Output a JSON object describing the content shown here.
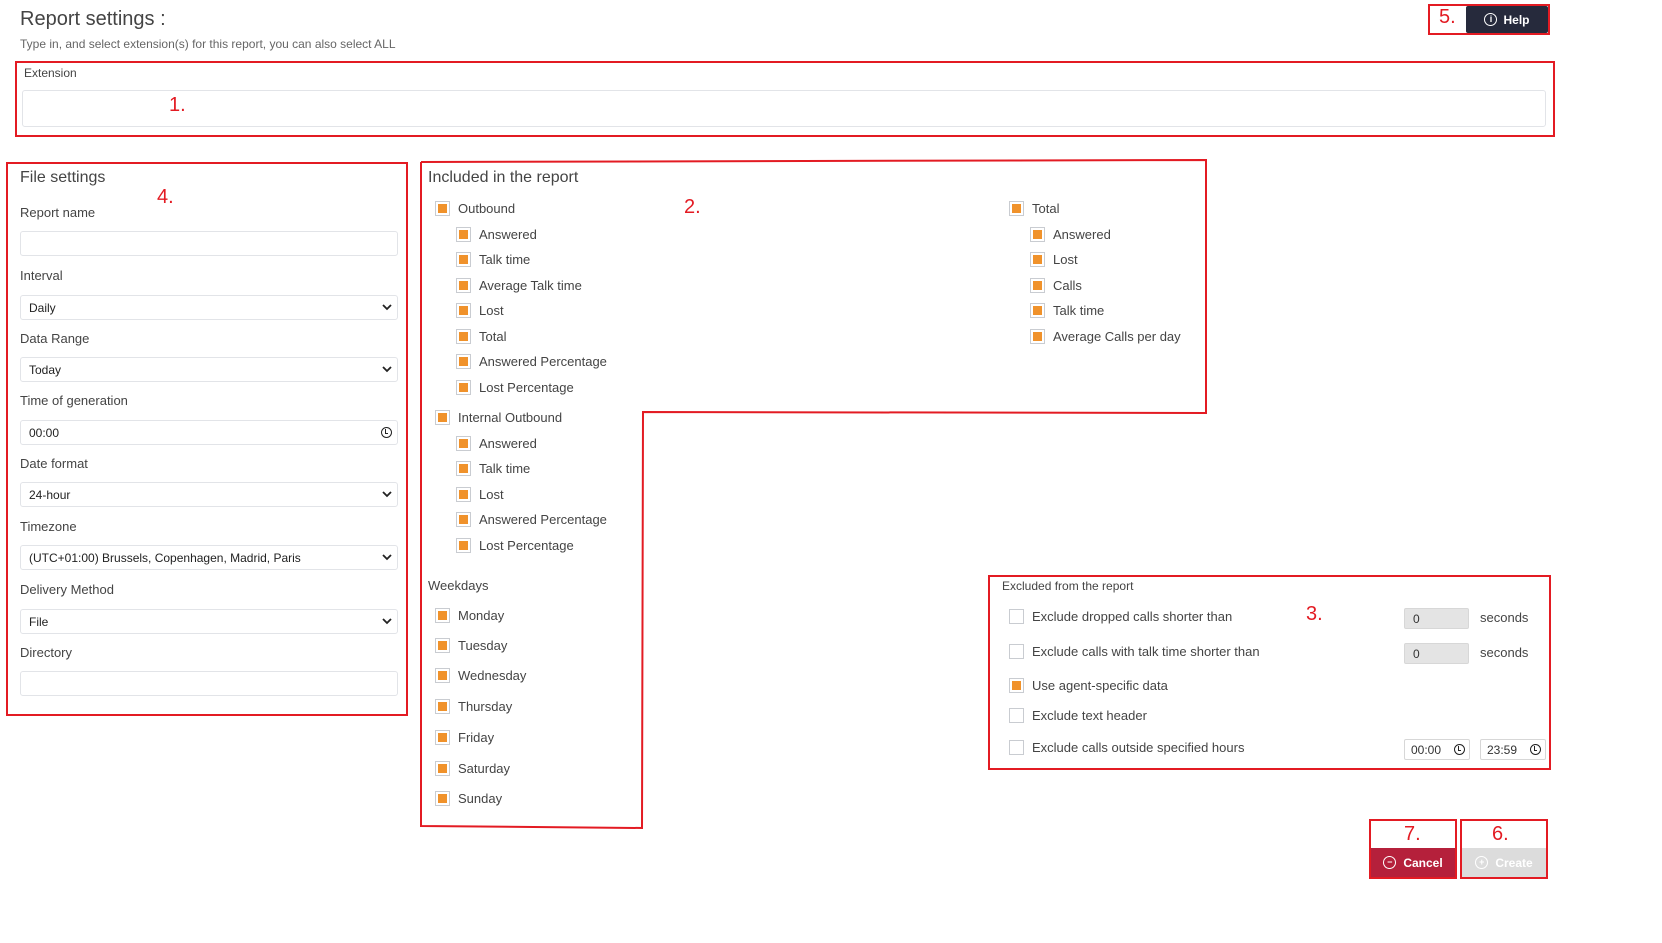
{
  "header": {
    "title": "Report settings :",
    "subtitle": "Type in, and select extension(s) for this report, you can also select ALL",
    "help_label": "Help"
  },
  "annotations": {
    "n1": "1.",
    "n2": "2.",
    "n3": "3.",
    "n4": "4.",
    "n5": "5.",
    "n6": "6.",
    "n7": "7."
  },
  "extension": {
    "label": "Extension",
    "value": ""
  },
  "file_settings": {
    "title": "File settings",
    "report_name": {
      "label": "Report name",
      "value": ""
    },
    "interval": {
      "label": "Interval",
      "value": "Daily"
    },
    "data_range": {
      "label": "Data Range",
      "value": "Today"
    },
    "time_of_generation": {
      "label": "Time of generation",
      "value": "00:00"
    },
    "date_format": {
      "label": "Date format",
      "value": "24-hour"
    },
    "timezone": {
      "label": "Timezone",
      "value": "(UTC+01:00) Brussels, Copenhagen, Madrid, Paris"
    },
    "delivery_method": {
      "label": "Delivery Method",
      "value": "File"
    },
    "directory": {
      "label": "Directory",
      "value": ""
    }
  },
  "included": {
    "title": "Included in the report",
    "outbound": {
      "label": "Outbound",
      "checked": true,
      "items": [
        {
          "label": "Answered",
          "checked": true
        },
        {
          "label": "Talk time",
          "checked": true
        },
        {
          "label": "Average Talk time",
          "checked": true
        },
        {
          "label": "Lost",
          "checked": true
        },
        {
          "label": "Total",
          "checked": true
        },
        {
          "label": "Answered Percentage",
          "checked": true
        },
        {
          "label": "Lost Percentage",
          "checked": true
        }
      ]
    },
    "internal_outbound": {
      "label": "Internal Outbound",
      "checked": true,
      "items": [
        {
          "label": "Answered",
          "checked": true
        },
        {
          "label": "Talk time",
          "checked": true
        },
        {
          "label": "Lost",
          "checked": true
        },
        {
          "label": "Answered Percentage",
          "checked": true
        },
        {
          "label": "Lost Percentage",
          "checked": true
        }
      ]
    },
    "total": {
      "label": "Total",
      "checked": true,
      "items": [
        {
          "label": "Answered",
          "checked": true
        },
        {
          "label": "Lost",
          "checked": true
        },
        {
          "label": "Calls",
          "checked": true
        },
        {
          "label": "Talk time",
          "checked": true
        },
        {
          "label": "Average Calls per day",
          "checked": true
        }
      ]
    },
    "weekdays": {
      "label": "Weekdays",
      "items": [
        {
          "label": "Monday",
          "checked": true
        },
        {
          "label": "Tuesday",
          "checked": true
        },
        {
          "label": "Wednesday",
          "checked": true
        },
        {
          "label": "Thursday",
          "checked": true
        },
        {
          "label": "Friday",
          "checked": true
        },
        {
          "label": "Saturday",
          "checked": true
        },
        {
          "label": "Sunday",
          "checked": true
        }
      ]
    }
  },
  "excluded": {
    "title": "Excluded from the report",
    "dropped": {
      "label": "Exclude dropped calls shorter than",
      "checked": false,
      "value": "0",
      "unit": "seconds"
    },
    "talk_time": {
      "label": "Exclude calls with talk time shorter than",
      "checked": false,
      "value": "0",
      "unit": "seconds"
    },
    "agent_specific": {
      "label": "Use agent-specific data",
      "checked": true
    },
    "text_header": {
      "label": "Exclude text header",
      "checked": false
    },
    "outside_hours": {
      "label": "Exclude calls outside specified hours",
      "checked": false,
      "from": "00:00",
      "to": "23:59"
    }
  },
  "footer": {
    "cancel_label": "Cancel",
    "create_label": "Create"
  },
  "colors": {
    "annotation_red": "#e31b23",
    "checkbox_orange": "#f0922b",
    "help_bg": "#262a3c",
    "cancel_bg": "#b5203b",
    "create_disabled_bg": "#dcdcdc"
  }
}
